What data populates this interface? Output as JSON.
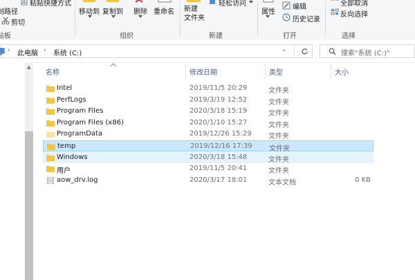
{
  "ribbon": {
    "clipboard": {
      "paste_shortcut": "粘贴快捷方式",
      "copy_path": "复制路径",
      "cut": "剪切",
      "group_label": "贴板"
    },
    "organize": {
      "move_to": "移动到",
      "copy_to": "复制到",
      "delete": "删除",
      "rename": "重命名",
      "group_label": "组织"
    },
    "new": {
      "new_folder": "新建\n文件夹",
      "easy_access": "轻松访问",
      "group_label": "新建"
    },
    "open": {
      "properties": "属性",
      "edit": "编辑",
      "history": "历史记录",
      "group_label": "打开"
    },
    "select": {
      "select_none": "全部取消",
      "invert_selection": "反向选择",
      "group_label": "选择"
    }
  },
  "address": {
    "crumbs": [
      "此电脑",
      "系统 (C:)"
    ],
    "search_placeholder": "搜索\"系统 (C:)\""
  },
  "columns": {
    "name": "名称",
    "date": "修改日期",
    "type": "类型",
    "size": "大小"
  },
  "files": [
    {
      "name": "Intel",
      "date": "2019/11/5 20:29",
      "type": "文件夹",
      "size": "",
      "kind": "folder"
    },
    {
      "name": "PerfLogs",
      "date": "2019/3/19 12:52",
      "type": "文件夹",
      "size": "",
      "kind": "folder"
    },
    {
      "name": "Program Files",
      "date": "2020/3/18 15:19",
      "type": "文件夹",
      "size": "",
      "kind": "folder"
    },
    {
      "name": "Program Files (x86)",
      "date": "2020/1/10 15:27",
      "type": "文件夹",
      "size": "",
      "kind": "folder"
    },
    {
      "name": "ProgramData",
      "date": "2019/12/26 15:29",
      "type": "文件夹",
      "size": "",
      "kind": "folder-light"
    },
    {
      "name": "temp",
      "date": "2019/12/16 17:39",
      "type": "文件夹",
      "size": "",
      "kind": "folder"
    },
    {
      "name": "Windows",
      "date": "2020/3/18 15:48",
      "type": "文件夹",
      "size": "",
      "kind": "folder"
    },
    {
      "name": "用户",
      "date": "2019/11/5 20:41",
      "type": "文件夹",
      "size": "",
      "kind": "folder"
    },
    {
      "name": "aow_drv.log",
      "date": "2020/3/17 18:01",
      "type": "文本文档",
      "size": "0 KB",
      "kind": "text"
    }
  ],
  "selected_row": "temp",
  "hover_row": "Windows",
  "colors": {
    "folder": "#f3c445",
    "folder_light": "#fbe3a1",
    "selection": "#cce8ff",
    "hover": "#e5f3ff",
    "header_text": "#4d6082"
  },
  "icons": [
    "paste-shortcut-icon",
    "copy-path-icon",
    "cut-icon",
    "move-to-icon",
    "copy-to-icon",
    "delete-icon",
    "rename-icon",
    "new-folder-icon",
    "easy-access-icon",
    "properties-icon",
    "edit-icon",
    "history-icon",
    "select-none-icon",
    "invert-selection-icon",
    "back-arrow-icon",
    "pc-icon",
    "chevron-down-icon",
    "refresh-icon",
    "search-icon",
    "sort-up-icon",
    "folder-icon",
    "text-file-icon"
  ]
}
